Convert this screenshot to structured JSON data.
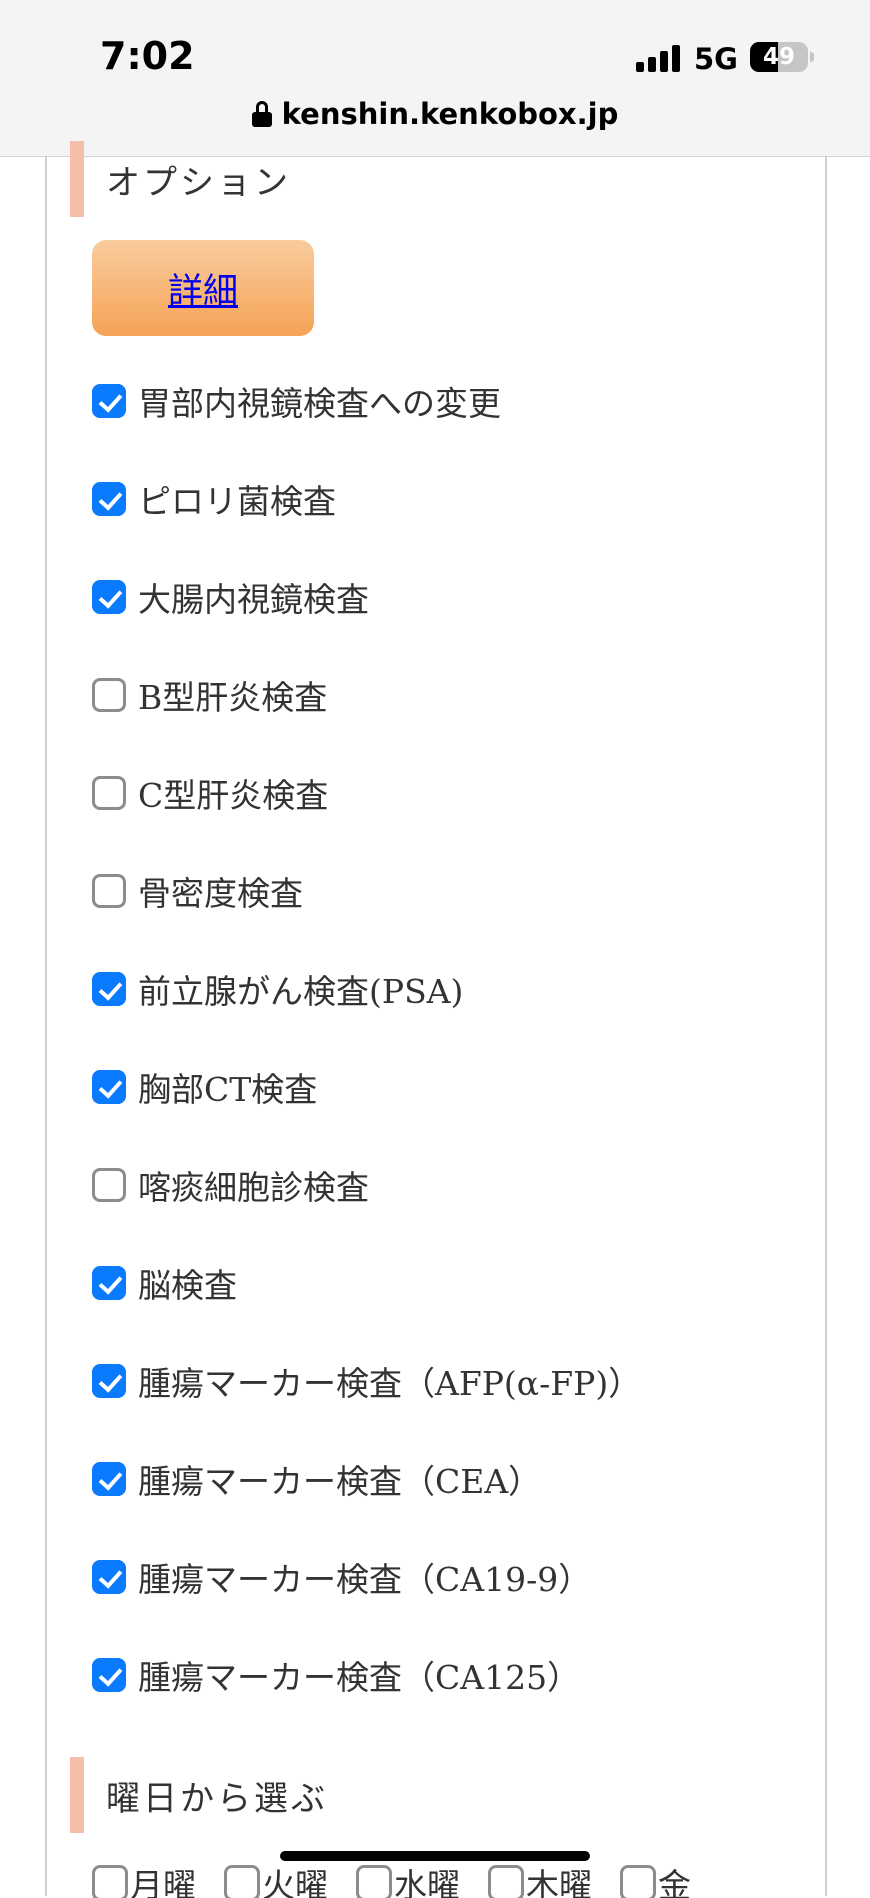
{
  "status_bar": {
    "time": "7:02",
    "network": "5G",
    "battery": "49",
    "battery_level": 0.49
  },
  "url_bar": {
    "url": "kenshin.kenkobox.jp"
  },
  "options_section": {
    "heading": "オプション",
    "detail_button": "詳細",
    "items": [
      {
        "label": "胃部内視鏡検査への変更",
        "checked": true
      },
      {
        "label": "ピロリ菌検査",
        "checked": true
      },
      {
        "label": "大腸内視鏡検査",
        "checked": true
      },
      {
        "label": "B型肝炎検査",
        "checked": false
      },
      {
        "label": "C型肝炎検査",
        "checked": false
      },
      {
        "label": "骨密度検査",
        "checked": false
      },
      {
        "label": "前立腺がん検査(PSA)",
        "checked": true
      },
      {
        "label": "胸部CT検査",
        "checked": true
      },
      {
        "label": "喀痰細胞診検査",
        "checked": false
      },
      {
        "label": "脳検査",
        "checked": true
      },
      {
        "label": "腫瘍マーカー検査（AFP(α-FP)）",
        "checked": true
      },
      {
        "label": "腫瘍マーカー検査（CEA）",
        "checked": true
      },
      {
        "label": "腫瘍マーカー検査（CA19-9）",
        "checked": true
      },
      {
        "label": "腫瘍マーカー検査（CA125）",
        "checked": true
      }
    ]
  },
  "weekday_section": {
    "heading": "曜日から選ぶ",
    "days": [
      {
        "label": "月曜",
        "checked": false
      },
      {
        "label": "火曜",
        "checked": false
      },
      {
        "label": "水曜",
        "checked": false
      },
      {
        "label": "木曜",
        "checked": false
      },
      {
        "label": "金",
        "checked": false
      }
    ]
  },
  "colors": {
    "accent_checkbox": "#0a7aff",
    "heading_bar": "#f4bea9",
    "detail_button_top": "#f8cc9e",
    "detail_button_bottom": "#f6a356"
  }
}
